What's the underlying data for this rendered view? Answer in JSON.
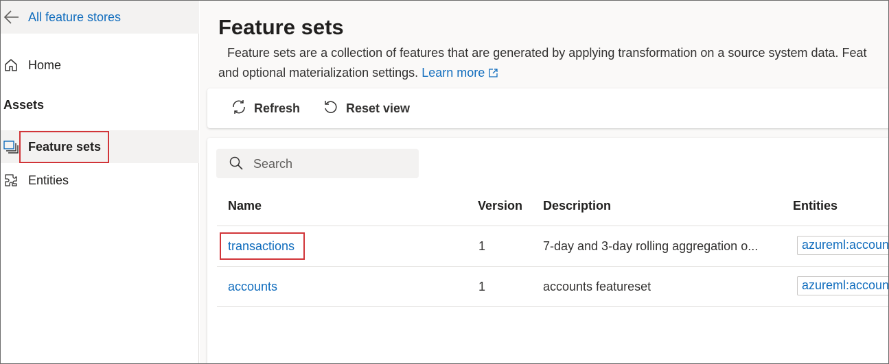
{
  "sidebar": {
    "back_label": "All feature stores",
    "home_label": "Home",
    "section_assets": "Assets",
    "feature_sets_label": "Feature sets",
    "entities_label": "Entities"
  },
  "main": {
    "title": "Feature sets",
    "description_line1": "Feature sets are a collection of features that are generated by applying transformation on a source system data. Feat",
    "description_line2": "and optional materialization settings.",
    "learn_more": "Learn more",
    "toolbar": {
      "refresh_label": "Refresh",
      "reset_view_label": "Reset view"
    },
    "search": {
      "placeholder": "Search",
      "value": ""
    },
    "table": {
      "headers": {
        "name": "Name",
        "version": "Version",
        "description": "Description",
        "entities": "Entities"
      },
      "rows": [
        {
          "name": "transactions",
          "version": "1",
          "description": "7-day and 3-day rolling aggregation o...",
          "entities": "azureml:accoun"
        },
        {
          "name": "accounts",
          "version": "1",
          "description": "accounts featureset",
          "entities": "azureml:accoun"
        }
      ]
    }
  },
  "colors": {
    "link": "#0f6cbd",
    "highlight": "#d13438",
    "selected_bg": "#f3f2f1"
  },
  "icons": [
    "back-arrow-icon",
    "home-icon",
    "feature-sets-icon",
    "entities-icon",
    "refresh-icon",
    "reset-view-icon",
    "search-icon",
    "external-link-icon"
  ]
}
